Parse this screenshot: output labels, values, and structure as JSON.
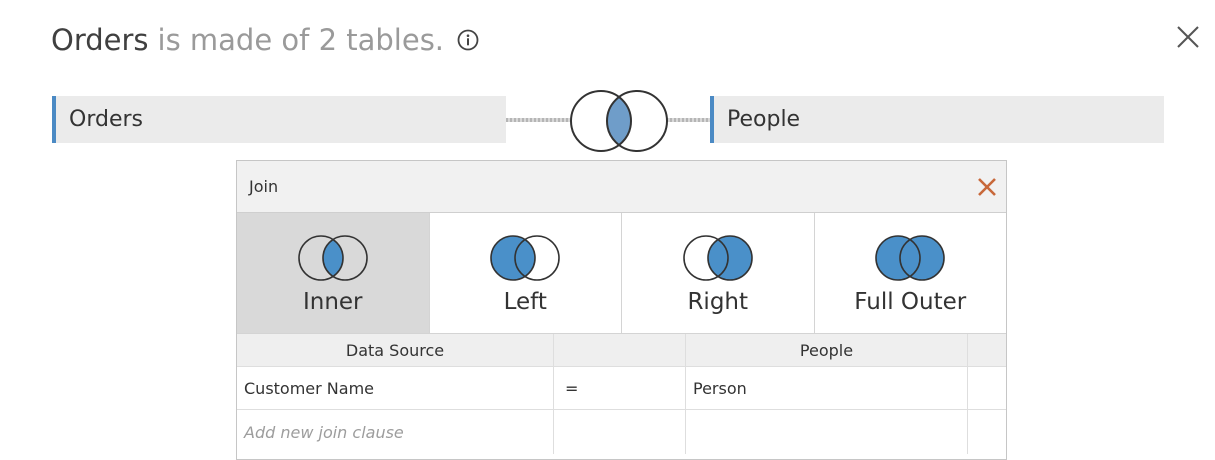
{
  "header": {
    "table_name": "Orders",
    "description": "is made of 2 tables.",
    "info_icon": "info-circle-icon",
    "close_icon": "close-icon"
  },
  "tables": {
    "left": "Orders",
    "right": "People",
    "join_icon": "inner-join-venn-icon"
  },
  "join_dialog": {
    "title": "Join",
    "close_icon": "close-icon",
    "join_types": [
      {
        "label": "Inner",
        "icon": "inner-join-icon",
        "selected": true
      },
      {
        "label": "Left",
        "icon": "left-join-icon",
        "selected": false
      },
      {
        "label": "Right",
        "icon": "right-join-icon",
        "selected": false
      },
      {
        "label": "Full Outer",
        "icon": "full-outer-join-icon",
        "selected": false
      }
    ],
    "grid": {
      "columns": [
        "Data Source",
        "",
        "People",
        ""
      ],
      "clauses": [
        {
          "left_field": "Customer Name",
          "operator": "=",
          "right_field": "Person"
        }
      ],
      "add_placeholder": "Add new join clause"
    }
  },
  "colors": {
    "accent": "#4b8ac4",
    "venn_fill": "#4a90c9",
    "dialog_close": "#c8683a",
    "selected_bg": "#d9d9d9"
  }
}
